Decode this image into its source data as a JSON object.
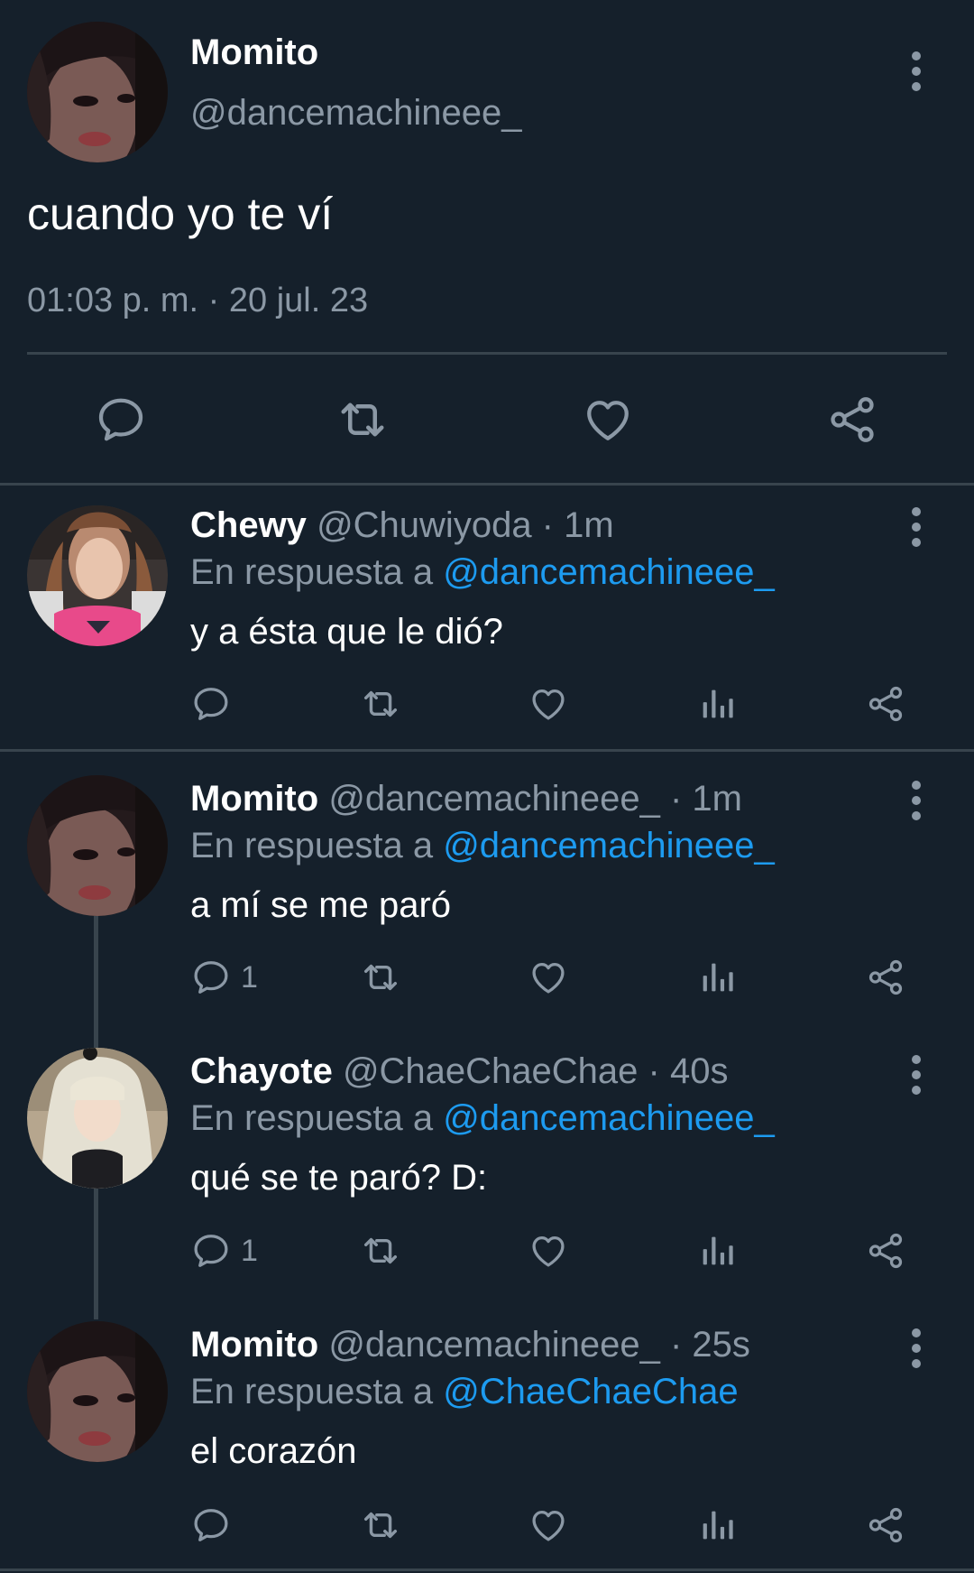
{
  "main_tweet": {
    "name": "Momito",
    "handle": "@dancemachineee_",
    "text": "cuando yo te ví",
    "timestamp": "01:03 p. m. · 20 jul. 23",
    "actions": [
      "reply-icon",
      "retweet-icon",
      "like-icon",
      "share-icon"
    ]
  },
  "replies": [
    {
      "name": "Chewy",
      "meta": "@Chuwiyoda · 1m",
      "reply_prefix": "En respuesta a ",
      "reply_to": "@dancemachineee_",
      "text": "y a ésta que le dió?",
      "reply_count": ""
    },
    {
      "name": "Momito",
      "meta": "@dancemachineee_ · 1m",
      "reply_prefix": "En respuesta a ",
      "reply_to": "@dancemachineee_",
      "text": "a mí se me paró",
      "reply_count": "1"
    },
    {
      "name": "Chayote",
      "meta": "@ChaeChaeChae · 40s",
      "reply_prefix": "En respuesta a ",
      "reply_to": "@dancemachineee_",
      "text": "qué se te paró? D:",
      "reply_count": "1"
    },
    {
      "name": "Momito",
      "meta": "@dancemachineee_ · 25s",
      "reply_prefix": "En respuesta a ",
      "reply_to": "@ChaeChaeChae",
      "text": "el corazón",
      "reply_count": ""
    }
  ],
  "colors": {
    "background": "#15202b",
    "secondary_text": "#8b98a5",
    "mention": "#1d9bf0",
    "divider": "#38444d"
  }
}
